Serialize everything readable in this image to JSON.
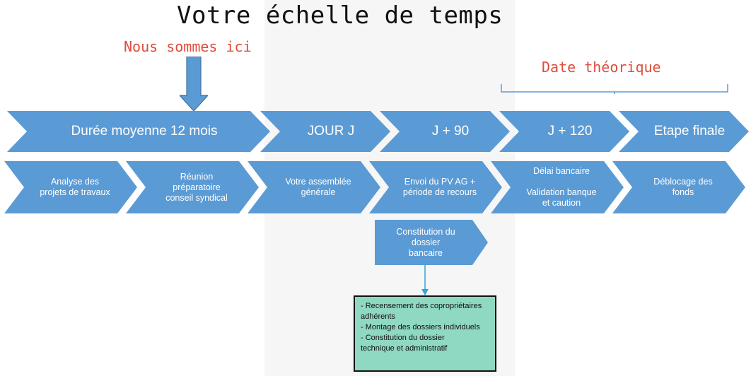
{
  "title": "Votre échelle de temps",
  "here_label": "Nous sommes ici",
  "date_label": "Date théorique",
  "phases": [
    {
      "label": "Durée moyenne 12 mois"
    },
    {
      "label": "JOUR  J"
    },
    {
      "label": "J + 90"
    },
    {
      "label": "J + 120"
    },
    {
      "label": "Etape finale"
    }
  ],
  "steps": [
    {
      "lines": [
        "Analyse des",
        "projets de travaux"
      ]
    },
    {
      "lines": [
        "Réunion",
        "préparatoire",
        "conseil syndical"
      ]
    },
    {
      "lines": [
        "Votre assemblée",
        "générale"
      ]
    },
    {
      "lines": [
        "Envoi du PV AG +",
        "période de recours"
      ]
    },
    {
      "lines": [
        "Délai bancaire",
        "Validation banque",
        "et caution"
      ]
    },
    {
      "lines": [
        "Déblocage des",
        "fonds"
      ]
    }
  ],
  "constitution": {
    "lines": [
      "Constitution du",
      "dossier",
      "bancaire"
    ]
  },
  "detail_box": {
    "lines": [
      "- Recensement des copropriétaires",
      "adhérents",
      "- Montage des dossiers individuels",
      "- Constitution du dossier",
      "technique et administratif"
    ]
  },
  "colors": {
    "chevron": "#5b9bd5",
    "accent_text": "#e04b3a",
    "detail_box": "#8fd8c1"
  }
}
